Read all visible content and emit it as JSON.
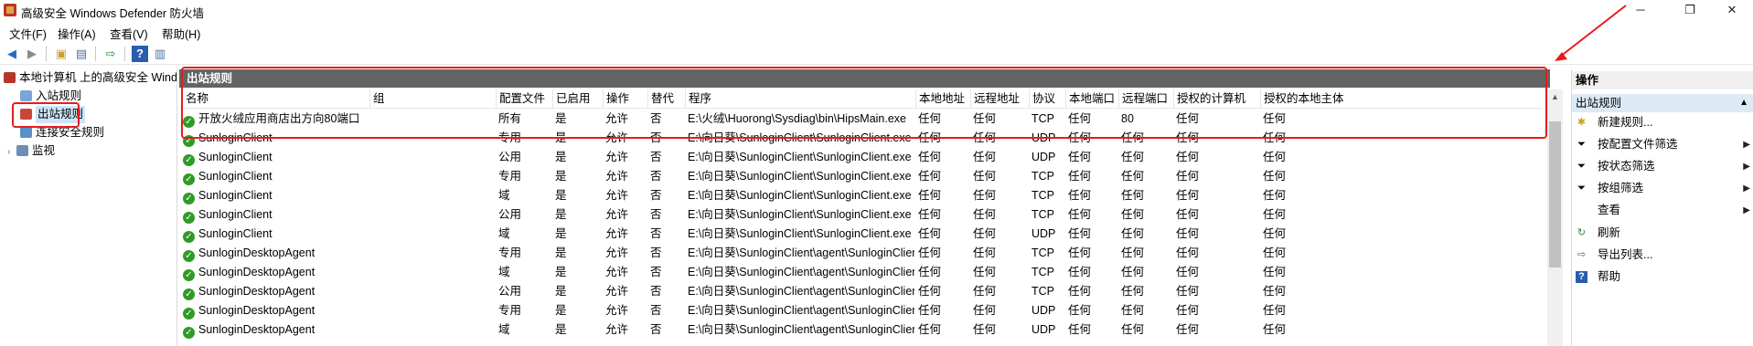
{
  "window": {
    "title": "高级安全 Windows Defender 防火墙",
    "minimize": "─",
    "restore": "❐",
    "close": "✕"
  },
  "menu": [
    "文件(F)",
    "操作(A)",
    "查看(V)",
    "帮助(H)"
  ],
  "tree": {
    "root": "本地计算机 上的高级安全 Windows Defender 防火墙",
    "items": [
      "入站规则",
      "出站规则",
      "连接安全规则",
      "监视"
    ]
  },
  "panel": {
    "title": "出站规则",
    "columns": [
      "名称",
      "组",
      "配置文件",
      "已启用",
      "操作",
      "替代",
      "程序",
      "本地地址",
      "远程地址",
      "协议",
      "本地端口",
      "远程端口",
      "授权的计算机",
      "授权的本地主体"
    ],
    "rows": [
      [
        "开放火绒应用商店出方向80端口",
        "",
        "所有",
        "是",
        "允许",
        "否",
        "E:\\火绒\\Huorong\\Sysdiag\\bin\\HipsMain.exe",
        "任何",
        "任何",
        "TCP",
        "任何",
        "80",
        "任何",
        "任何"
      ],
      [
        "SunloginClient",
        "",
        "专用",
        "是",
        "允许",
        "否",
        "E:\\向日葵\\SunloginClient\\SunloginClient.exe",
        "任何",
        "任何",
        "UDP",
        "任何",
        "任何",
        "任何",
        "任何"
      ],
      [
        "SunloginClient",
        "",
        "公用",
        "是",
        "允许",
        "否",
        "E:\\向日葵\\SunloginClient\\SunloginClient.exe",
        "任何",
        "任何",
        "UDP",
        "任何",
        "任何",
        "任何",
        "任何"
      ],
      [
        "SunloginClient",
        "",
        "专用",
        "是",
        "允许",
        "否",
        "E:\\向日葵\\SunloginClient\\SunloginClient.exe",
        "任何",
        "任何",
        "TCP",
        "任何",
        "任何",
        "任何",
        "任何"
      ],
      [
        "SunloginClient",
        "",
        "域",
        "是",
        "允许",
        "否",
        "E:\\向日葵\\SunloginClient\\SunloginClient.exe",
        "任何",
        "任何",
        "TCP",
        "任何",
        "任何",
        "任何",
        "任何"
      ],
      [
        "SunloginClient",
        "",
        "公用",
        "是",
        "允许",
        "否",
        "E:\\向日葵\\SunloginClient\\SunloginClient.exe",
        "任何",
        "任何",
        "TCP",
        "任何",
        "任何",
        "任何",
        "任何"
      ],
      [
        "SunloginClient",
        "",
        "域",
        "是",
        "允许",
        "否",
        "E:\\向日葵\\SunloginClient\\SunloginClient.exe",
        "任何",
        "任何",
        "UDP",
        "任何",
        "任何",
        "任何",
        "任何"
      ],
      [
        "SunloginDesktopAgent",
        "",
        "专用",
        "是",
        "允许",
        "否",
        "E:\\向日葵\\SunloginClient\\agent\\SunloginClient.exe",
        "任何",
        "任何",
        "TCP",
        "任何",
        "任何",
        "任何",
        "任何"
      ],
      [
        "SunloginDesktopAgent",
        "",
        "域",
        "是",
        "允许",
        "否",
        "E:\\向日葵\\SunloginClient\\agent\\SunloginClient.exe",
        "任何",
        "任何",
        "TCP",
        "任何",
        "任何",
        "任何",
        "任何"
      ],
      [
        "SunloginDesktopAgent",
        "",
        "公用",
        "是",
        "允许",
        "否",
        "E:\\向日葵\\SunloginClient\\agent\\SunloginClient.exe",
        "任何",
        "任何",
        "TCP",
        "任何",
        "任何",
        "任何",
        "任何"
      ],
      [
        "SunloginDesktopAgent",
        "",
        "专用",
        "是",
        "允许",
        "否",
        "E:\\向日葵\\SunloginClient\\agent\\SunloginClient.exe",
        "任何",
        "任何",
        "UDP",
        "任何",
        "任何",
        "任何",
        "任何"
      ],
      [
        "SunloginDesktopAgent",
        "",
        "域",
        "是",
        "允许",
        "否",
        "E:\\向日葵\\SunloginClient\\agent\\SunloginClient.exe",
        "任何",
        "任何",
        "UDP",
        "任何",
        "任何",
        "任何",
        "任何"
      ]
    ]
  },
  "actions": {
    "title": "操作",
    "section": "出站规则",
    "items": [
      {
        "label": "新建规则...",
        "icon": "new-rule-icon",
        "submenu": false
      },
      {
        "label": "按配置文件筛选",
        "icon": "filter-icon",
        "submenu": true
      },
      {
        "label": "按状态筛选",
        "icon": "filter-icon",
        "submenu": true
      },
      {
        "label": "按组筛选",
        "icon": "filter-icon",
        "submenu": true
      },
      {
        "label": "查看",
        "icon": "",
        "submenu": true
      },
      {
        "label": "刷新",
        "icon": "refresh-icon",
        "submenu": false
      },
      {
        "label": "导出列表...",
        "icon": "export-icon",
        "submenu": false
      },
      {
        "label": "帮助",
        "icon": "help-icon",
        "submenu": false
      }
    ]
  },
  "colors": {
    "header_bg": "#646464",
    "highlight_red": "#e81b1b",
    "check_green": "#2f9b27",
    "selection_blue": "#cce4f7"
  }
}
